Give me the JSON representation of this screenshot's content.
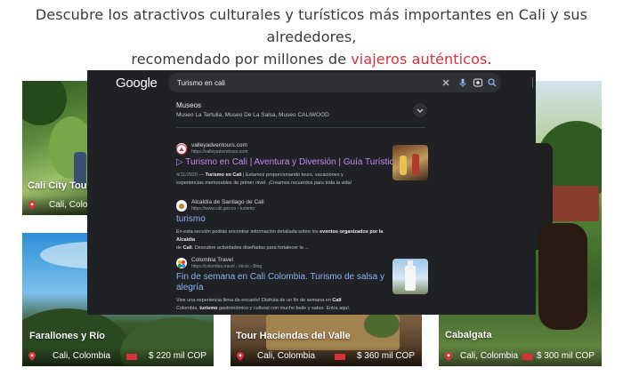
{
  "headline": {
    "line1": "Descubre los atractivos culturales y turísticos más importantes en Cali y sus alrededores,",
    "line2_start": "recomendado por millones de",
    "line2_accent": "viajeros auténticos",
    "line2_end": ".",
    "accent_color": "#d9313c"
  },
  "cards": [
    {
      "title": "Cali City Tours",
      "city": "Cali, Colo",
      "price": ""
    },
    {
      "title": "Farallones y Río",
      "city": "Cali, Colombia",
      "price": "$ 220 mil COP"
    },
    {
      "title": "Tour Haciendas del Valle",
      "city": "Cali, Colombia",
      "price": "$ 360 mil COP"
    },
    {
      "title": "Cabalgata",
      "city": "Cali, Colombia",
      "price": "$ 300 mil COP"
    }
  ],
  "google": {
    "logo": "Google",
    "query": "Turismo en cali",
    "icons": [
      "clear-icon",
      "mic-icon",
      "lens-icon",
      "search-icon"
    ],
    "museos": {
      "title": "Museos",
      "list": "Museo La Tertulia, Museo De La Salsa, Museo CALIWOOD"
    },
    "results": [
      {
        "site": "valleyadventours.com",
        "url": "https://valleyadventours.com",
        "title": "▷ Turismo en Cali | Aventura y Diversión | Guía Turística",
        "date": "4/11/2020",
        "snippet_bold": "Turismo en Cali",
        "snippet_1": "| Estamos proporcionando tours, vacaciones y",
        "snippet_2": "experiencias memorables de primer nivel. ¡Creamos recuerdos para toda la vida!"
      },
      {
        "site": "Alcaldía de Santiago de Cali",
        "url": "https://www.cali.gov.co › turismo",
        "title": "turismo",
        "snippet_1": "En esta sección podrás encontrar información detallada sobre los",
        "snippet_bold_1": "eventos organizados por la Alcaldía",
        "snippet_2a": "de",
        "snippet_bold_2": "Cali",
        "snippet_2b": ". Descubre actividades diseñadas para fortalecer la ..."
      },
      {
        "site": "Colombia Travel",
        "url": "https://colombia.travel › Inicio › Blog",
        "title_1": "Fin de semana en Cali Colombia. Turismo de salsa y",
        "title_2": "alegría",
        "snippet_1a": "Vive una experiencia llena de encanto! Disfruta de un fin de semana en",
        "snippet_bold_1": "Cali",
        "snippet_2a": "Colombia,",
        "snippet_bold_2": "turismo",
        "snippet_2b": "gastronómico y cultural con mucho baile y sabor. Entra aquí."
      }
    ]
  }
}
